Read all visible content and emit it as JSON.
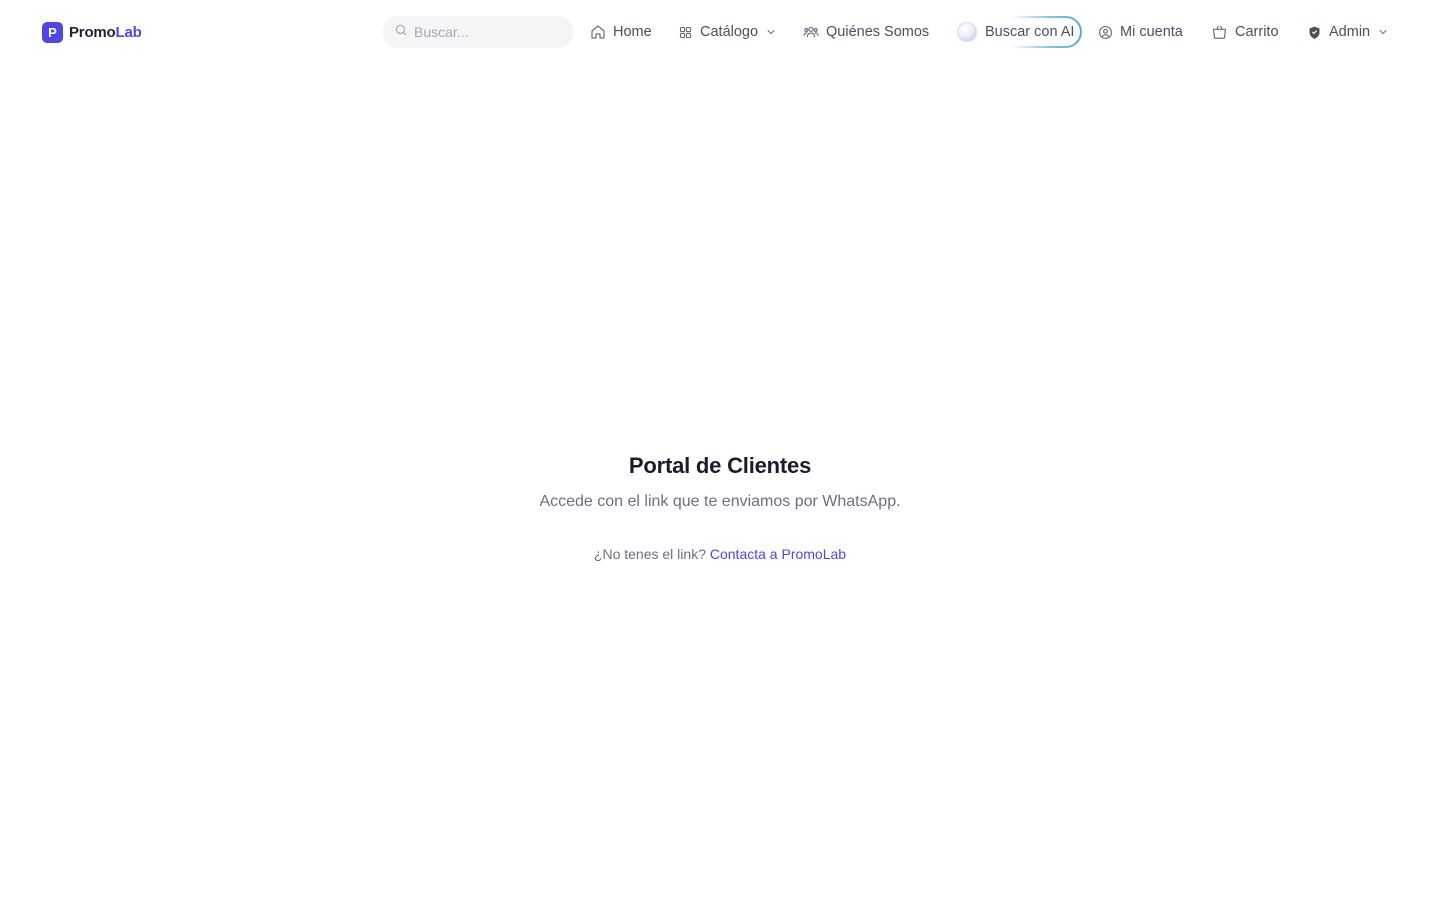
{
  "brand": {
    "logo_letter": "P",
    "name_part1": "Promo",
    "name_part2": "Lab"
  },
  "search": {
    "placeholder": "Buscar..."
  },
  "nav": {
    "home": "Home",
    "catalog": "Catálogo",
    "about": "Quiénes Somos",
    "ai_search": "Buscar con AI",
    "account": "Mi cuenta",
    "cart": "Carrito",
    "admin": "Admin"
  },
  "main": {
    "title": "Portal de Clientes",
    "subtitle": "Accede con el link que te enviamos por WhatsApp.",
    "help_text": "¿No tenes el link?",
    "help_link": "Contacta a PromoLab"
  },
  "colors": {
    "accent": "#4f46e5",
    "text": "#1a1c2c",
    "muted": "#6b7080",
    "ai_ring": "#4fb0dd"
  }
}
